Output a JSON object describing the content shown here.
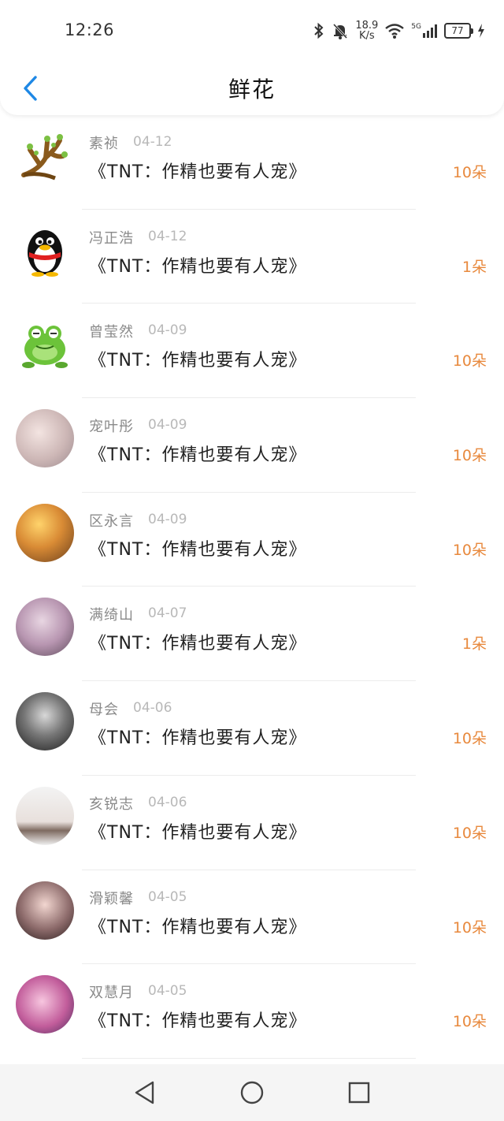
{
  "status_bar": {
    "time": "12:26",
    "net_speed_value": "18.9",
    "net_speed_unit": "K/s",
    "signal_label": "5G",
    "battery": "77"
  },
  "nav": {
    "title": "鲜花",
    "back_icon": "chevron-left-icon"
  },
  "colors": {
    "accent": "#1e88e5",
    "count": "#e8893d",
    "name": "#8a8a8a",
    "date": "#b8b8b8"
  },
  "items": [
    {
      "name": "素祯",
      "date": "04-12",
      "book": "《TNT：作精也要有人宠》",
      "count": "10朵",
      "avatar": "tree-avatar"
    },
    {
      "name": "冯正浩",
      "date": "04-12",
      "book": "《TNT：作精也要有人宠》",
      "count": "1朵",
      "avatar": "penguin-avatar"
    },
    {
      "name": "曾莹然",
      "date": "04-09",
      "book": "《TNT：作精也要有人宠》",
      "count": "10朵",
      "avatar": "frog-avatar"
    },
    {
      "name": "宠叶彤",
      "date": "04-09",
      "book": "《TNT：作精也要有人宠》",
      "count": "10朵",
      "avatar": "photo-avatar"
    },
    {
      "name": "区永言",
      "date": "04-09",
      "book": "《TNT：作精也要有人宠》",
      "count": "10朵",
      "avatar": "photo-avatar"
    },
    {
      "name": "满绮山",
      "date": "04-07",
      "book": "《TNT：作精也要有人宠》",
      "count": "1朵",
      "avatar": "photo-avatar"
    },
    {
      "name": "母会",
      "date": "04-06",
      "book": "《TNT：作精也要有人宠》",
      "count": "10朵",
      "avatar": "photo-avatar"
    },
    {
      "name": "亥锐志",
      "date": "04-06",
      "book": "《TNT：作精也要有人宠》",
      "count": "10朵",
      "avatar": "photo-avatar"
    },
    {
      "name": "滑颖馨",
      "date": "04-05",
      "book": "《TNT：作精也要有人宠》",
      "count": "10朵",
      "avatar": "photo-avatar"
    },
    {
      "name": "双慧月",
      "date": "04-05",
      "book": "《TNT：作精也要有人宠》",
      "count": "10朵",
      "avatar": "photo-avatar"
    }
  ],
  "system_nav": {
    "back": "triangle-back-icon",
    "home": "circle-home-icon",
    "recents": "square-recents-icon"
  }
}
